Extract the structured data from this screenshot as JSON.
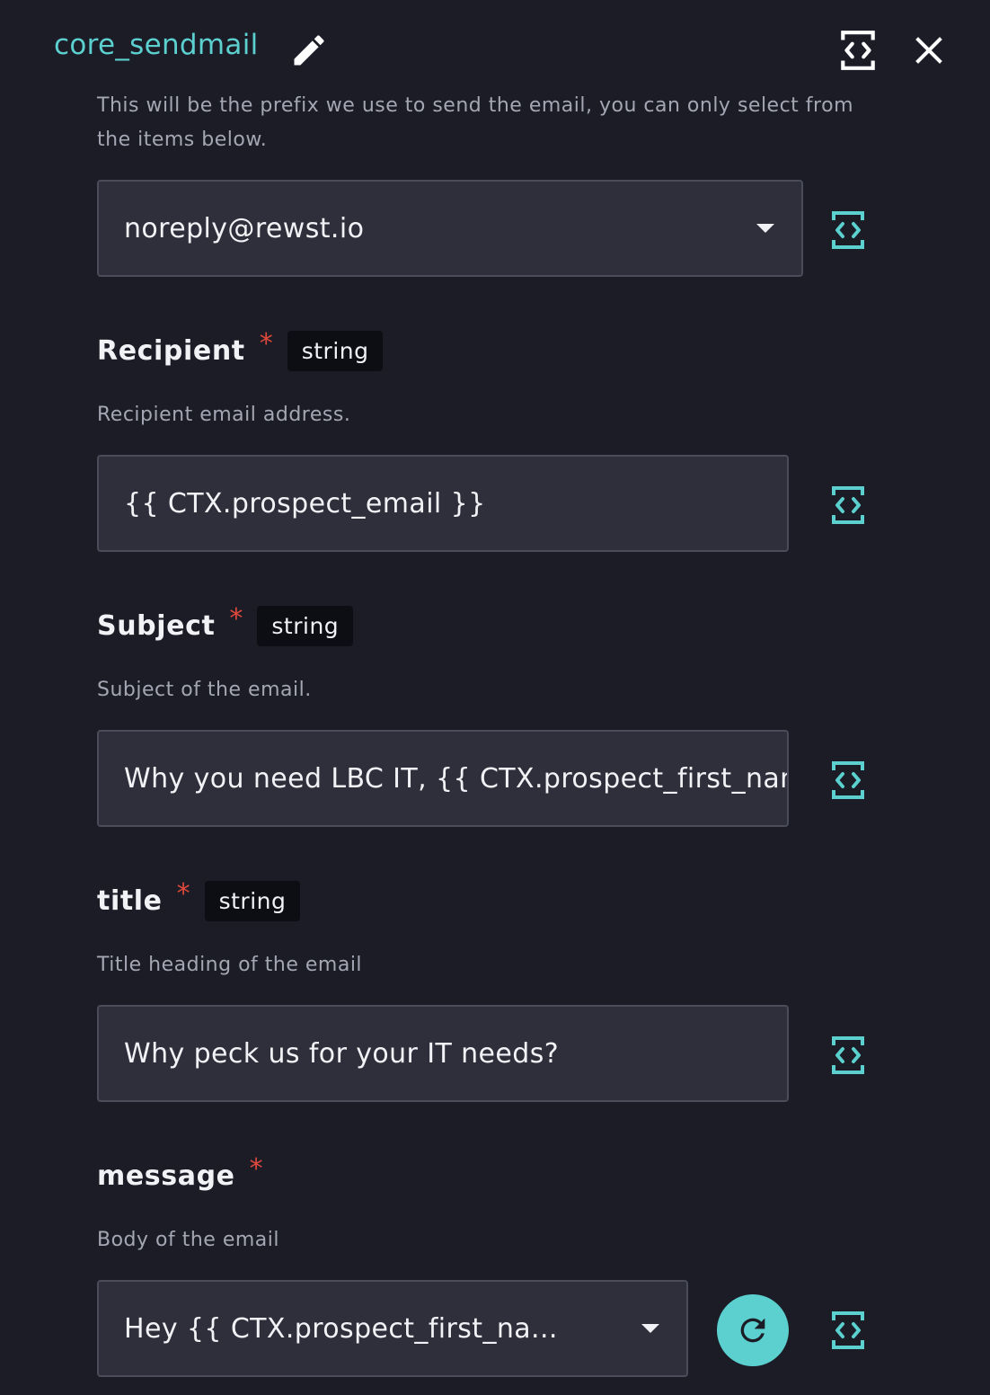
{
  "header": {
    "title": "core_sendmail",
    "icons": [
      "pencil-icon",
      "code-brackets-icon",
      "close-icon"
    ]
  },
  "sender": {
    "description_line1": "This will be the prefix we use to send the email, you can only select from",
    "description_line2": "the items below.",
    "value": "noreply@rewst.io"
  },
  "recipient": {
    "label": "Recipient",
    "required_mark": "*",
    "type": "string",
    "description": "Recipient email address.",
    "value": "{{ CTX.prospect_email }}"
  },
  "subject": {
    "label": "Subject",
    "required_mark": "*",
    "type": "string",
    "description": "Subject of the email.",
    "value": "Why you need LBC IT, {{ CTX.prospect_first_name"
  },
  "title_field": {
    "label": "title",
    "required_mark": "*",
    "type": "string",
    "description": "Title heading of the email",
    "value": "Why peck us for your IT needs?"
  },
  "message": {
    "label": "message",
    "required_mark": "*",
    "description": "Body of the email",
    "value": "Hey {{ CTX.prospect_first_na..."
  },
  "colors": {
    "accent": "#5ccfcf",
    "background": "#1b1c26",
    "field_bg": "#2e2f3b",
    "required": "#e0483c"
  }
}
